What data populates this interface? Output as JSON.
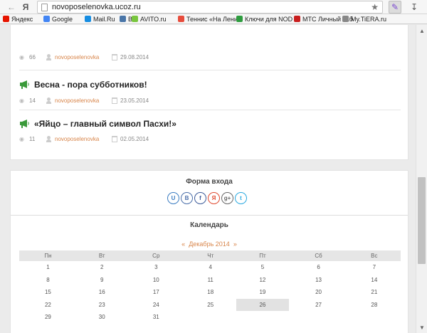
{
  "browser": {
    "url": "novoposelenovka.ucoz.ru",
    "bookmarks": [
      {
        "label": "Яндекс",
        "icon": "yandex-icon",
        "color": "#e61400"
      },
      {
        "label": "Google",
        "icon": "google-icon",
        "color": "#4285f4"
      },
      {
        "label": "Mail.Ru",
        "icon": "mailru-icon",
        "color": "#168de2"
      },
      {
        "label": "ВК",
        "icon": "vk-icon",
        "color": "#4a76a8"
      },
      {
        "label": "AVITO.ru",
        "icon": "avito-icon",
        "color": "#79c63e"
      },
      {
        "label": "Теннис «На Лени",
        "icon": "tennis-icon",
        "color": "#e74c3c"
      },
      {
        "label": "Ключи для NOD",
        "icon": "nod-icon",
        "color": "#2e9c3f"
      },
      {
        "label": "МТС Личный каб",
        "icon": "mts-icon",
        "color": "#c91f1f"
      },
      {
        "label": "My.TiERA.ru",
        "icon": "tiera-icon",
        "color": "#888888"
      }
    ]
  },
  "news": [
    {
      "title": "",
      "views": "66",
      "author": "novoposelenovka",
      "date": "29.08.2014"
    },
    {
      "title": "Весна - пора субботников!",
      "views": "14",
      "author": "novoposelenovka",
      "date": "23.05.2014"
    },
    {
      "title": "«Яйцо – главный символ Пасхи!»",
      "views": "11",
      "author": "novoposelenovka",
      "date": "02.05.2014"
    }
  ],
  "login": {
    "title": "Форма входа",
    "social": [
      {
        "label": "U",
        "icon": "ucoz-icon",
        "color": "#3a7cc1"
      },
      {
        "label": "В",
        "icon": "vk-icon",
        "color": "#4a6ea9"
      },
      {
        "label": "f",
        "icon": "facebook-icon",
        "color": "#3b5998"
      },
      {
        "label": "Я",
        "icon": "yandex-icon",
        "color": "#e04a2f"
      },
      {
        "label": "g+",
        "icon": "google-plus-icon",
        "color": "#666666"
      },
      {
        "label": "t",
        "icon": "twitter-icon",
        "color": "#2aa9e0"
      }
    ]
  },
  "calendar": {
    "title": "Календарь",
    "prev": "«",
    "month": "Декабрь 2014",
    "next": "»",
    "weekdays": [
      "Пн",
      "Вт",
      "Ср",
      "Чт",
      "Пт",
      "Сб",
      "Вс"
    ],
    "weeks": [
      [
        "1",
        "2",
        "3",
        "4",
        "5",
        "6",
        "7"
      ],
      [
        "8",
        "9",
        "10",
        "11",
        "12",
        "13",
        "14"
      ],
      [
        "15",
        "16",
        "17",
        "18",
        "19",
        "20",
        "21"
      ],
      [
        "22",
        "23",
        "24",
        "25",
        "26",
        "27",
        "28"
      ],
      [
        "29",
        "30",
        "31",
        "",
        "",
        "",
        ""
      ]
    ],
    "today": "26",
    "accent": "#d8854a"
  }
}
